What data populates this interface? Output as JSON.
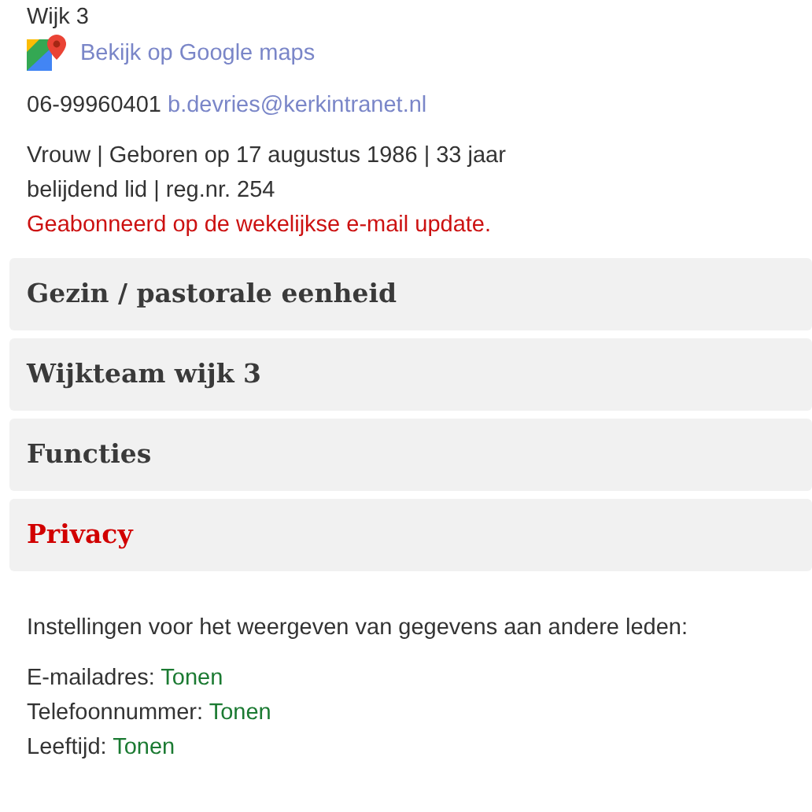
{
  "district": "Wijk 3",
  "maps_link": "Bekijk op Google maps",
  "phone": "06-99960401",
  "email": "b.devries@kerkintranet.nl",
  "details": [
    "Vrouw | Geboren op 17 augustus 1986 | 33 jaar",
    "belijdend lid | reg.nr. 254"
  ],
  "subscription": "Geabonneerd op de wekelijkse e-mail update.",
  "sections": [
    {
      "title": "Gezin / pastorale eenheid",
      "expanded": false
    },
    {
      "title": "Wijkteam wijk 3",
      "expanded": false
    },
    {
      "title": "Functies",
      "expanded": false
    },
    {
      "title": "Privacy",
      "expanded": true
    }
  ],
  "privacy": {
    "intro": "Instellingen voor het weergeven van gegevens aan andere leden:",
    "settings": [
      {
        "label": "E-mailadres:",
        "value": "Tonen"
      },
      {
        "label": "Telefoonnummer:",
        "value": "Tonen"
      },
      {
        "label": "Leeftijd:",
        "value": "Tonen"
      }
    ]
  }
}
